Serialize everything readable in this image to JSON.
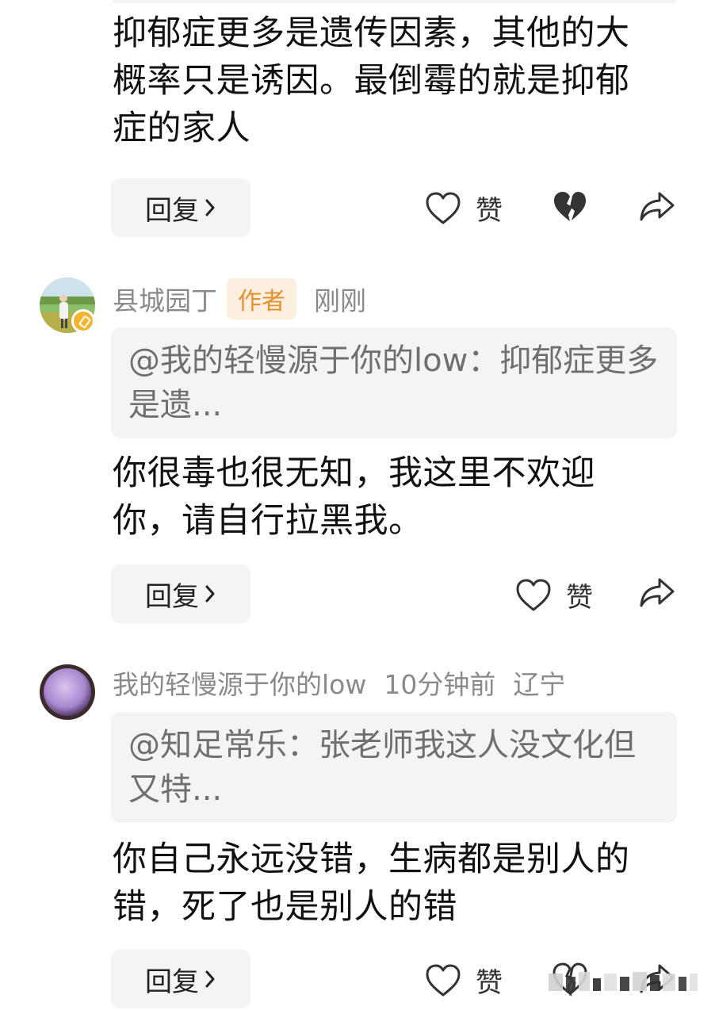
{
  "comments": [
    {
      "text": "抑郁症更多是遗传因素，其他的大概率只是诱因。最倒霉的就是抑郁症的家人",
      "reply_label": "回复",
      "like_label": "赞"
    },
    {
      "username": "县城园丁",
      "author_tag": "作者",
      "time": "刚刚",
      "quote": "@我的轻慢源于你的low：抑郁症更多是遗...",
      "text": "你很毒也很无知，我这里不欢迎你，请自行拉黑我。",
      "reply_label": "回复",
      "like_label": "赞"
    },
    {
      "username": "我的轻慢源于你的low",
      "time": "10分钟前",
      "location": "辽宁",
      "quote": "@知足常乐：张老师我这人没文化但又特...",
      "text": "你自己永远没错，生病都是别人的错，死了也是别人的错",
      "reply_label": "回复",
      "like_label": "赞"
    }
  ],
  "icons": {
    "like": "heart-outline-icon",
    "dislike": "broken-heart-icon",
    "share": "share-arrow-icon",
    "chevron": "chevron-right-icon"
  },
  "colors": {
    "author_tag_text": "#e3902e",
    "author_tag_bg": "#fcefe0",
    "meta_gray": "#8a8a8a",
    "quote_bg": "#f4f4f4",
    "badge": "#f3b530"
  }
}
